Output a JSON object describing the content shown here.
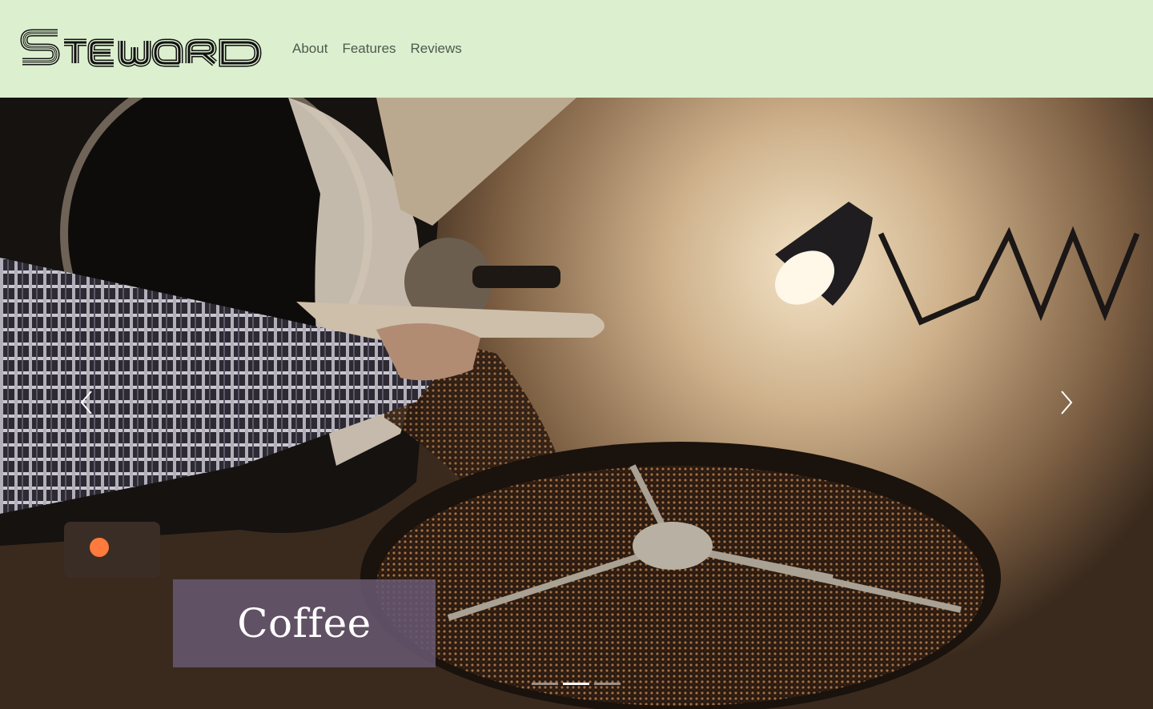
{
  "brand": {
    "name": "Steward"
  },
  "nav": {
    "items": [
      "About",
      "Features",
      "Reviews"
    ]
  },
  "carousel": {
    "slide_caption": "Coffee",
    "indicator_count": 3,
    "active_index": 1,
    "image_subject": "coffee-roaster-photo"
  },
  "icons": {
    "prev": "chevron-left-icon",
    "next": "chevron-right-icon"
  },
  "colors": {
    "header_bg": "#dcefcf",
    "nav_text": "#4f5a4c",
    "caption_bg": "#675770",
    "caption_text": "#ffffff"
  }
}
